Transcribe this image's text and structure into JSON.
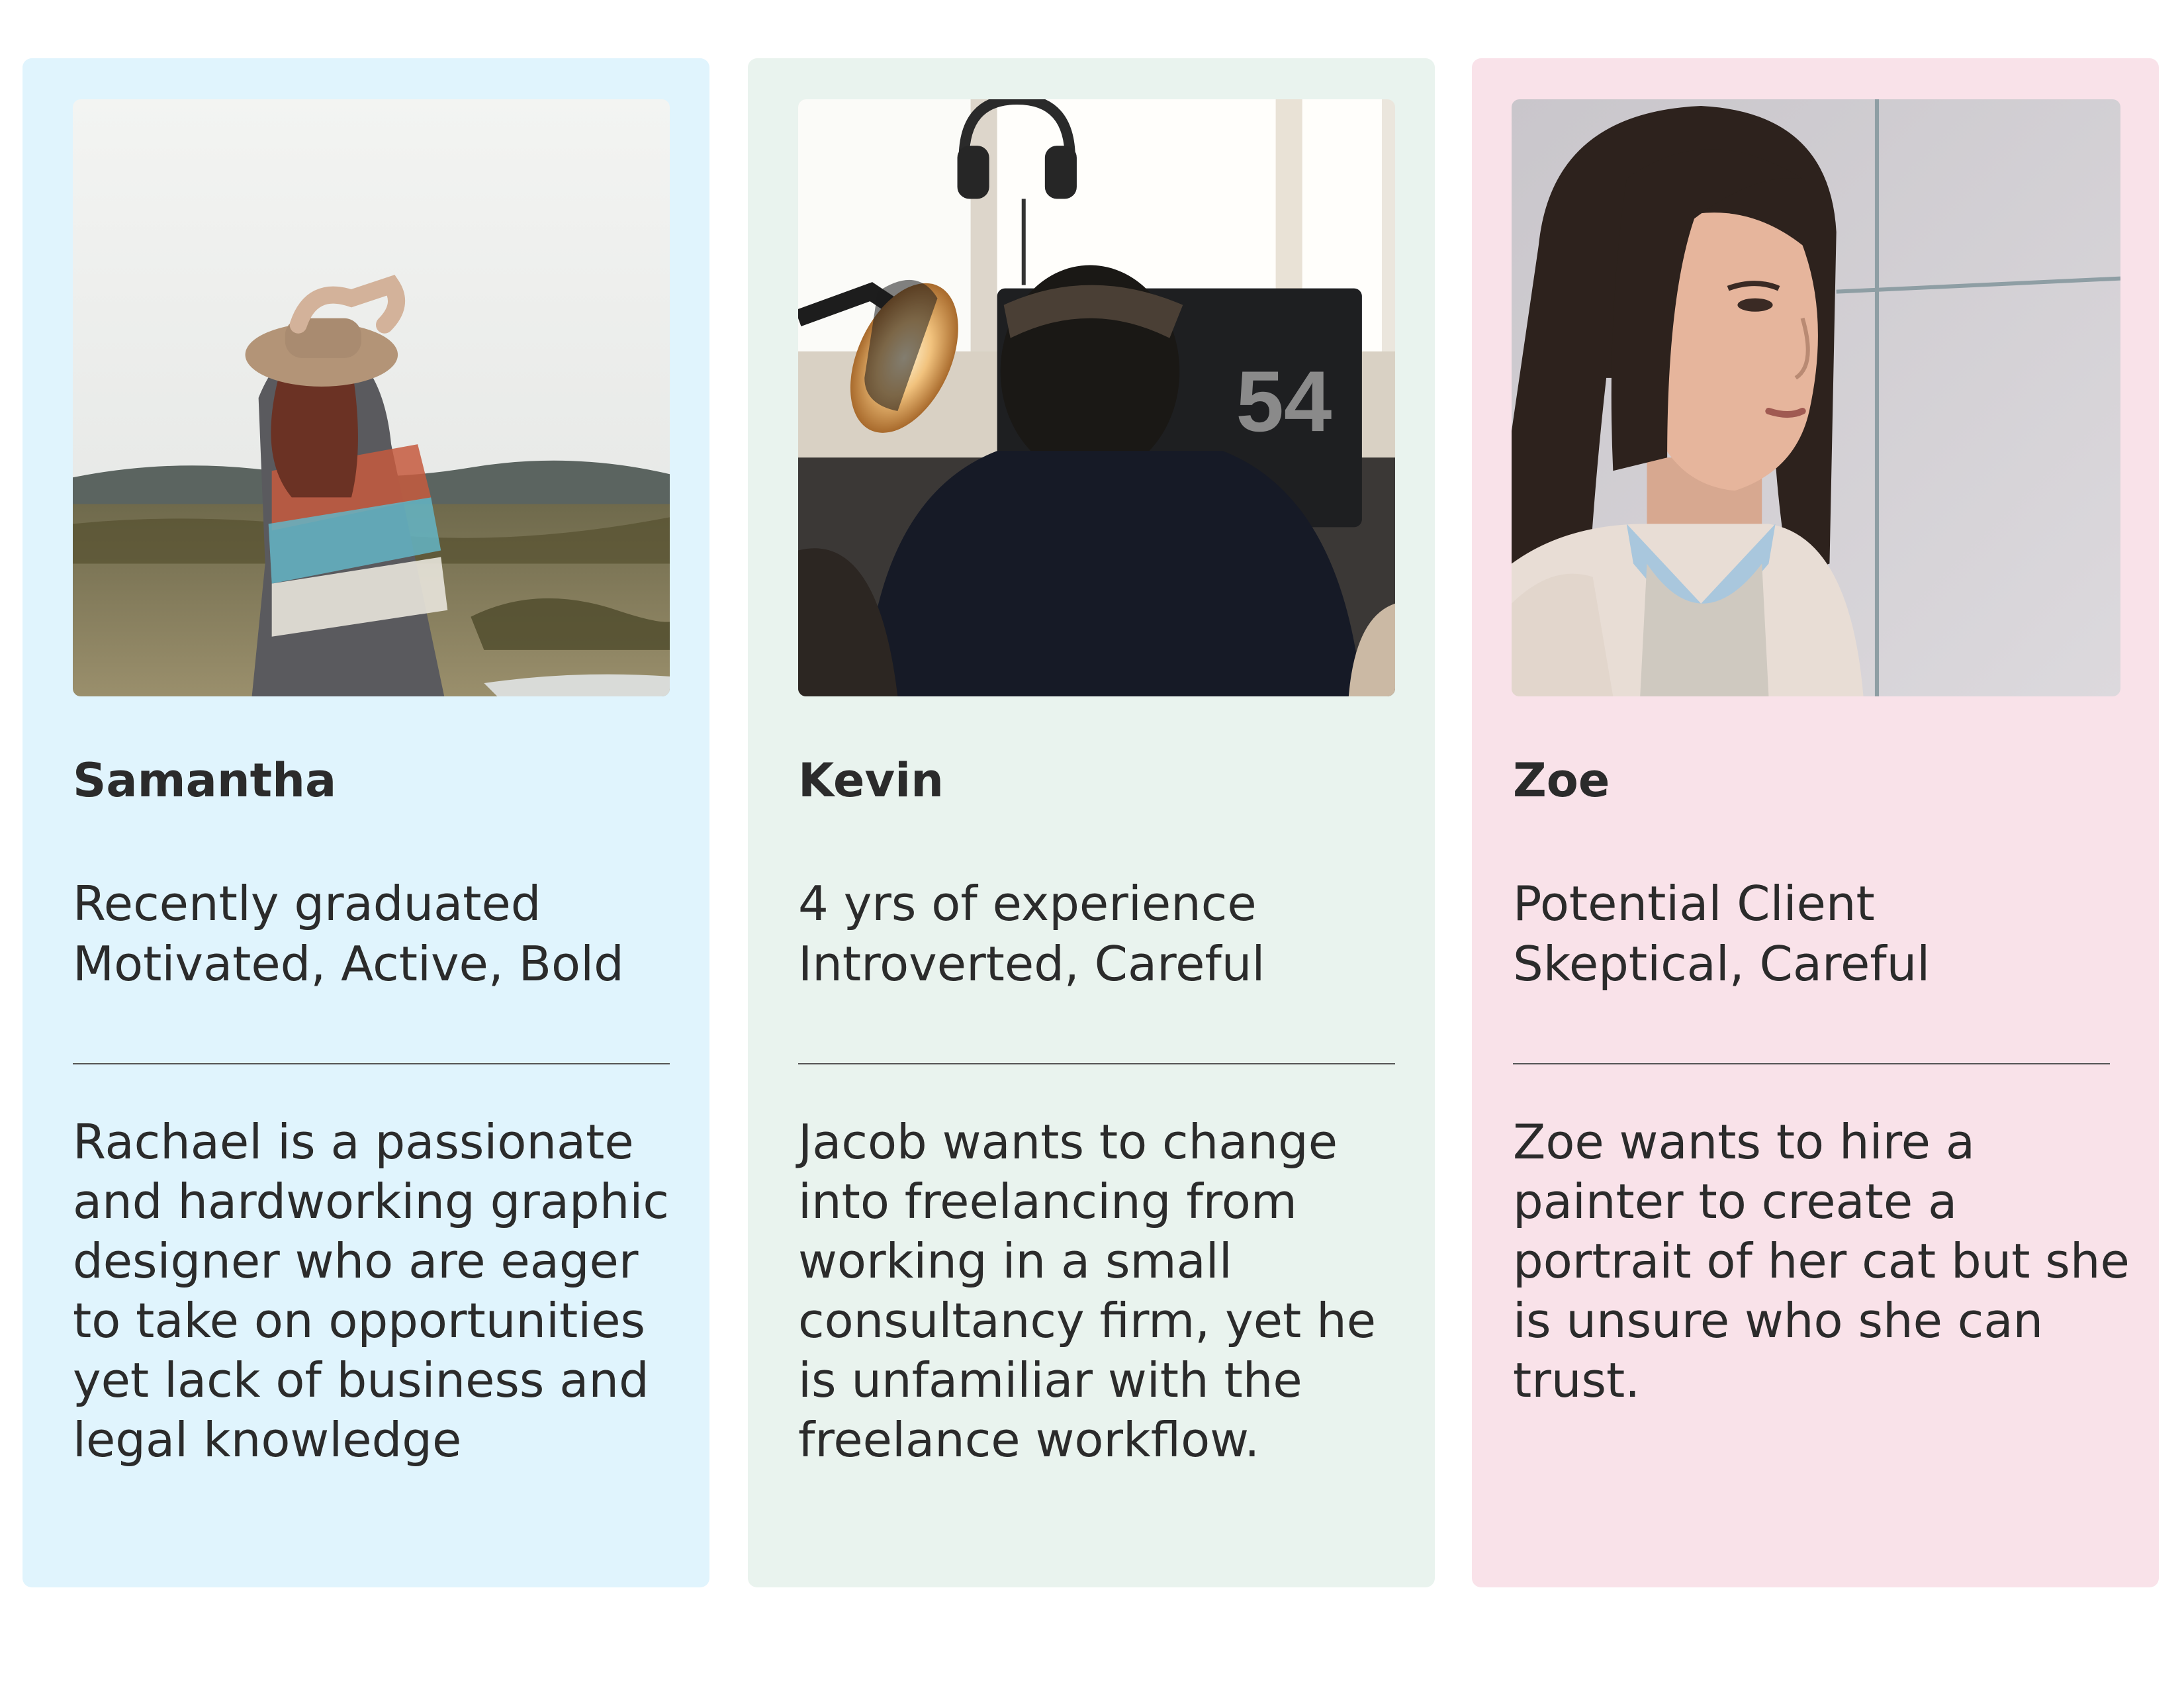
{
  "personas": [
    {
      "name": "Samantha",
      "meta": [
        "Recently graduated",
        "Motivated, Active, Bold"
      ],
      "bio": "Rachael is a passionate and hardworking graphic designer who are eager to take on opportunities yet lack of business and legal knowledge",
      "bg_color": "#e0f4fd"
    },
    {
      "name": "Kevin",
      "meta": [
        "4 yrs of experience",
        "Introverted, Careful"
      ],
      "bio": "Jacob wants to change into freelancing from working in a small consultancy firm, yet he is unfamiliar with the freelance workflow.",
      "bg_color": "#e9f3ee",
      "photo_text": "54"
    },
    {
      "name": "Zoe",
      "meta": [
        "Potential Client",
        "Skeptical, Careful"
      ],
      "bio": "Zoe wants to hire a painter to create a portrait of her cat but she is unsure who she can trust.",
      "bg_color": "#f9e2e9"
    }
  ]
}
